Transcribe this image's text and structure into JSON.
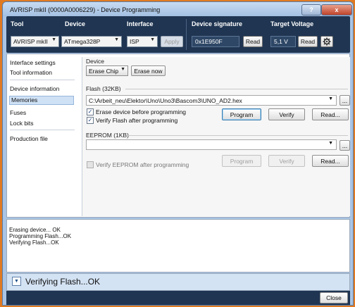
{
  "window": {
    "title": "AVRISP mkII (0000A0006229) - Device Programming",
    "help_glyph": "?",
    "close_glyph": "x"
  },
  "toolbar": {
    "tool_label": "Tool",
    "tool_value": "AVRISP mkII",
    "device_label": "Device",
    "device_value": "ATmega328P",
    "interface_label": "Interface",
    "interface_value": "ISP",
    "apply_label": "Apply",
    "signature_label": "Device signature",
    "signature_value": "0x1E950F",
    "signature_read_label": "Read",
    "voltage_label": "Target Voltage",
    "voltage_value": "5,1 V",
    "voltage_read_label": "Read"
  },
  "sidebar": {
    "items": [
      {
        "label": "Interface settings"
      },
      {
        "label": "Tool information"
      },
      {
        "label": "Device information"
      },
      {
        "label": "Memories"
      },
      {
        "label": "Fuses"
      },
      {
        "label": "Lock bits"
      },
      {
        "label": "Production file"
      }
    ],
    "selected": "Memories"
  },
  "device_group": {
    "label": "Device",
    "erase_select": "Erase Chip",
    "erase_now": "Erase now"
  },
  "flash_group": {
    "label": "Flash (32KB)",
    "path": "C:\\Arbeit_neu\\Elektor\\Uno\\Uno3\\Bascom3\\UNO_AD2.hex",
    "browse": "...",
    "erase_before": "Erase device before programming",
    "verify_after": "Verify Flash after programming",
    "program": "Program",
    "verify": "Verify",
    "read": "Read..."
  },
  "eeprom_group": {
    "label": "EEPROM (1KB)",
    "path": "",
    "browse": "...",
    "verify_after": "Verify EEPROM after programming",
    "program": "Program",
    "verify": "Verify",
    "read": "Read..."
  },
  "log": {
    "lines": [
      "Erasing device... OK",
      "Programming Flash...OK",
      "Verifying Flash...OK"
    ]
  },
  "status": {
    "text": "Verifying Flash...OK"
  },
  "footer": {
    "close_label": "Close"
  },
  "colors": {
    "toolbar_bg": "#1f3552",
    "selection_bg": "#cfe1f5",
    "outer_bg": "#e07a22"
  }
}
